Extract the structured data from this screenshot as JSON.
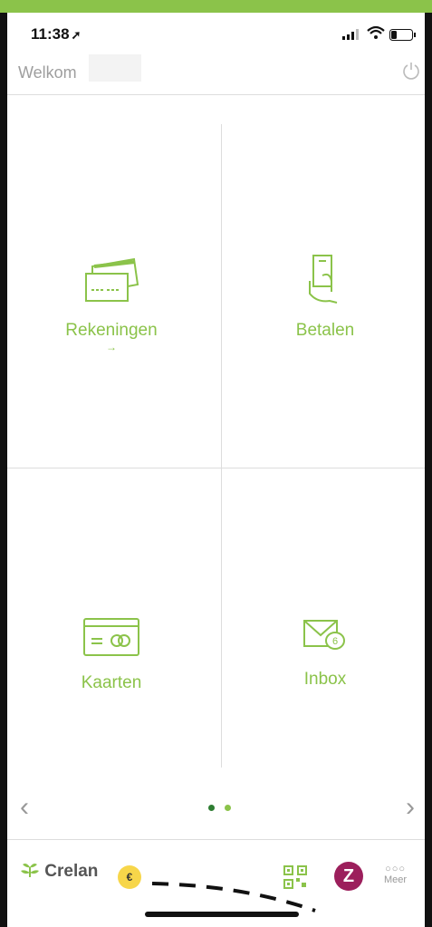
{
  "status": {
    "time": "11:38"
  },
  "header": {
    "welcome": "Welkom"
  },
  "tiles": [
    {
      "label": "Rekeningen",
      "sub": "→",
      "icon": "cards-icon"
    },
    {
      "label": "Betalen",
      "icon": "hand-card-icon"
    },
    {
      "label": "Kaarten",
      "icon": "card-icon"
    },
    {
      "label": "Inbox",
      "icon": "mail-icon",
      "badge": "6"
    }
  ],
  "pager": {
    "prev": "‹",
    "next": "›",
    "pages": 2,
    "active": 0
  },
  "bottom": {
    "brand": "Crelan",
    "coin": "€",
    "z": "Z",
    "meer_dots": "○○○",
    "meer": "Meer"
  },
  "colors": {
    "accent": "#8bc34a",
    "z": "#9c1f5c",
    "coin": "#f7d64a"
  }
}
